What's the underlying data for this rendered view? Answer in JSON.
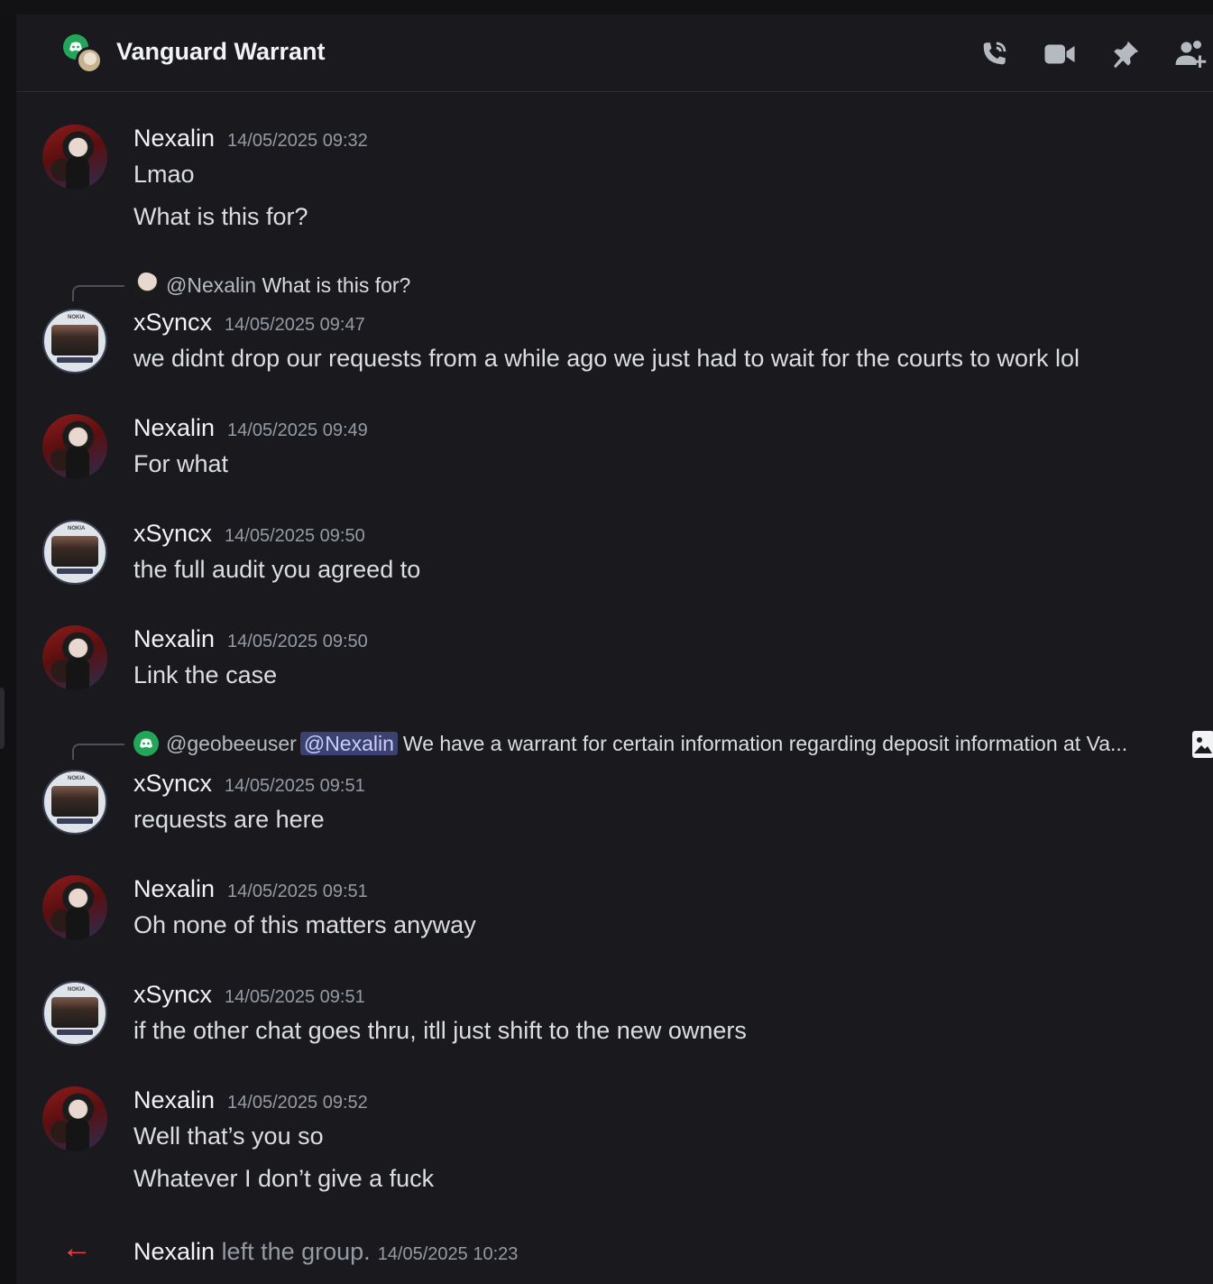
{
  "header": {
    "title": "Vanguard Warrant",
    "icons": [
      "phone-call-icon",
      "video-camera-icon",
      "pin-icon",
      "add-friend-icon"
    ]
  },
  "colors": {
    "background": "#1a1a1e",
    "mention_pill": "#3c4270",
    "leave_arrow": "#f23f43",
    "group_icon_green": "#23a55a"
  },
  "messages": [
    {
      "author": "Nexalin",
      "timestamp": "14/05/2025 09:32",
      "lines": [
        "Lmao",
        "What is this for?"
      ]
    },
    {
      "reply": {
        "prefix": "@Nexalin",
        "text": "What is this for?"
      },
      "author": "xSyncx",
      "timestamp": "14/05/2025 09:47",
      "lines": [
        "we didnt drop our requests from a while ago we just had to wait for the courts to work lol"
      ]
    },
    {
      "author": "Nexalin",
      "timestamp": "14/05/2025 09:49",
      "lines": [
        "For what"
      ]
    },
    {
      "author": "xSyncx",
      "timestamp": "14/05/2025 09:50",
      "lines": [
        "the full audit you agreed to"
      ]
    },
    {
      "author": "Nexalin",
      "timestamp": "14/05/2025 09:50",
      "lines": [
        "Link the case"
      ]
    },
    {
      "reply": {
        "prefix": "@geobeeuser",
        "mention": "@Nexalin",
        "text": "We have a warrant for certain information regarding deposit information at Va..."
      },
      "author": "xSyncx",
      "timestamp": "14/05/2025 09:51",
      "lines": [
        "requests are here"
      ]
    },
    {
      "author": "Nexalin",
      "timestamp": "14/05/2025 09:51",
      "lines": [
        "Oh none of this matters anyway"
      ]
    },
    {
      "author": "xSyncx",
      "timestamp": "14/05/2025 09:51",
      "lines": [
        "if the other chat goes thru, itll just shift to the new owners"
      ]
    },
    {
      "author": "Nexalin",
      "timestamp": "14/05/2025 09:52",
      "lines": [
        "Well that’s you so",
        "Whatever I don’t give a fuck"
      ]
    }
  ],
  "system": {
    "name": "Nexalin",
    "action": "left the group.",
    "timestamp": "14/05/2025 10:23"
  },
  "avatar_label": "NOKIA"
}
